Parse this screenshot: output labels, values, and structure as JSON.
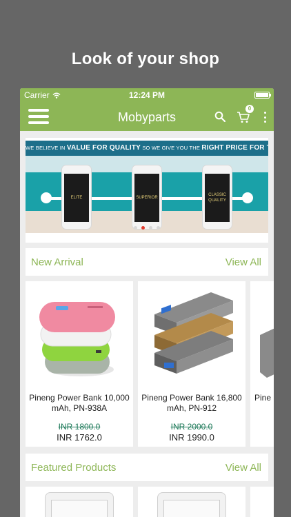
{
  "headline": "Look of your shop",
  "status_bar": {
    "carrier": "Carrier",
    "time": "12:24 PM"
  },
  "app_bar": {
    "title": "Mobyparts",
    "cart_count": "0"
  },
  "banner": {
    "tagline_part1": "WE BELIEVE IN",
    "tagline_bold1": "VALUE FOR QUALITY",
    "tagline_part2": "SO WE GIVE YOU THE",
    "tagline_bold2": "RIGHT PRICE FOR THE RIGHT QUALITY",
    "phones": [
      "ELITE",
      "SUPERIOR",
      "CLASSIC QUALITY"
    ],
    "active_slide_index": 1,
    "slide_count": 4
  },
  "new_arrival": {
    "title": "New Arrival",
    "view_all": "View All",
    "products": [
      {
        "name": "Pineng Power Bank 10,000 mAh, PN-938A",
        "old_price": "INR 1800.0",
        "price": "INR 1762.0"
      },
      {
        "name": "Pineng Power Bank 16,800 mAh, PN-912",
        "old_price": "INR 2000.0",
        "price": "INR 1990.0"
      },
      {
        "name": "Pine"
      }
    ]
  },
  "featured": {
    "title": "Featured Products",
    "view_all": "View All"
  },
  "colors": {
    "brand_green": "#8db656",
    "background": "#666666",
    "old_price": "#1f7a5a"
  }
}
